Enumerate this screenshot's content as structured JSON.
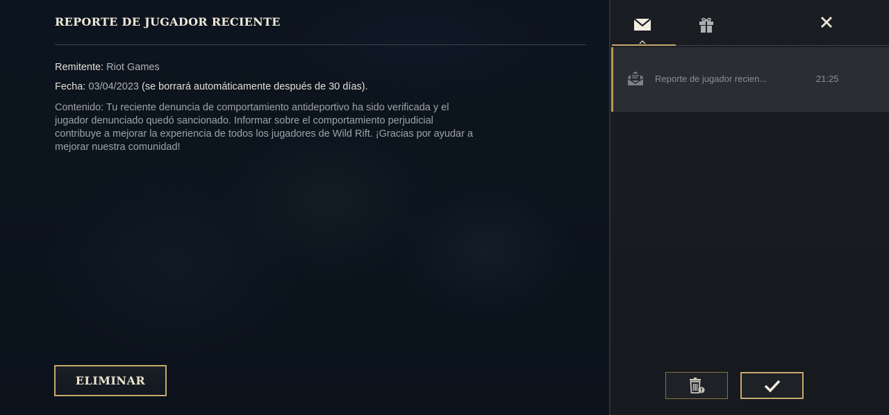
{
  "mail": {
    "title": "REPORTE DE JUGADOR RECIENTE",
    "sender_label": "Remitente:",
    "sender_value": "Riot Games",
    "date_label": "Fecha:",
    "date_value": "03/04/2023",
    "date_note": "(se borrará automáticamente después de 30 días).",
    "content": "Contenido: Tu reciente denuncia de comportamiento antideportivo ha sido verificada y el jugador denunciado quedó sancionado. Informar sobre el comportamiento perjudicial contribuye a mejorar la experiencia de todos los jugadores de Wild Rift. ¡Gracias por ayudar a mejorar nuestra comunidad!",
    "delete_label": "ELIMINAR"
  },
  "side_panel": {
    "tabs": [
      {
        "icon": "envelope-icon",
        "active": true
      },
      {
        "icon": "gift-icon",
        "active": false
      }
    ],
    "close_icon": "close-icon",
    "mail_list": [
      {
        "icon": "opened-envelope-icon",
        "subject": "Reporte de jugador recien...",
        "time": "21:25"
      }
    ],
    "footer": {
      "trash_icon": "trash-icon",
      "confirm_icon": "checkmark-icon"
    }
  },
  "colors": {
    "gold_accent": "#c8aa6e",
    "panel_bg": "#1a1d22",
    "selected_item_bg": "#2a2e33"
  }
}
